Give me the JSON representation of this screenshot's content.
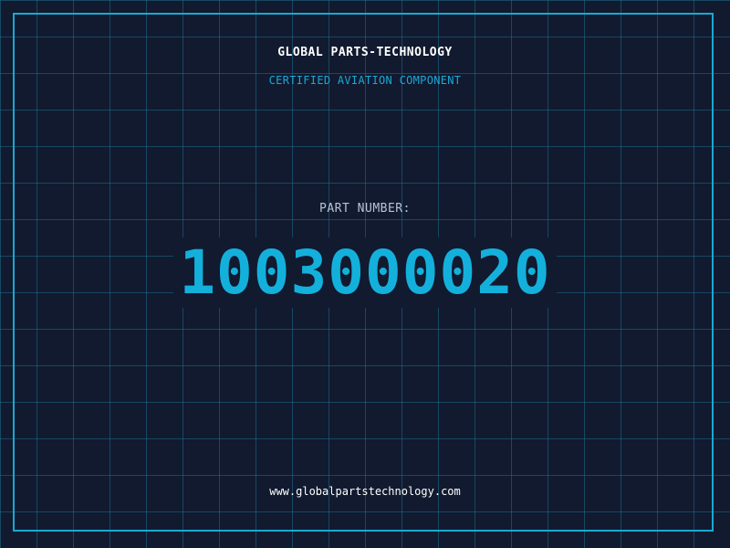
{
  "header": {
    "company": "GLOBAL PARTS-TECHNOLOGY",
    "tagline": "CERTIFIED AVIATION COMPONENT"
  },
  "part": {
    "label": "PART NUMBER:",
    "number": "1003000020"
  },
  "footer": {
    "website": "www.globalpartstechnology.com"
  },
  "colors": {
    "background": "#111a2f",
    "grid": "#1e6e8c",
    "accent": "#17a9d3",
    "text": "#ffffff",
    "label": "#b8c4d4"
  }
}
